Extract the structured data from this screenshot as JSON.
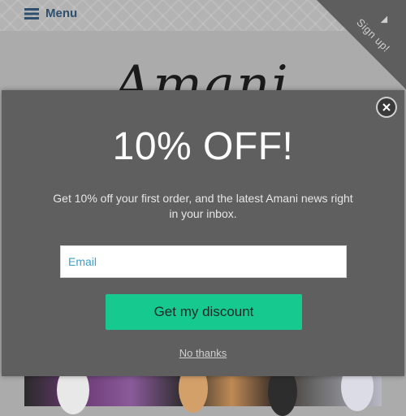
{
  "header": {
    "menu_label": "Menu",
    "signup_label": "Sign up!"
  },
  "logo": {
    "text": "Amani"
  },
  "popup": {
    "headline": "10% OFF!",
    "subtext": "Get 10% off your first order, and the latest Amani news right in your inbox.",
    "email_placeholder": "Email",
    "button_label": "Get my discount",
    "dismiss_label": "No thanks"
  },
  "colors": {
    "accent": "#16c98e",
    "popup_bg": "#5f5f5f",
    "link": "#3aa0c8"
  }
}
